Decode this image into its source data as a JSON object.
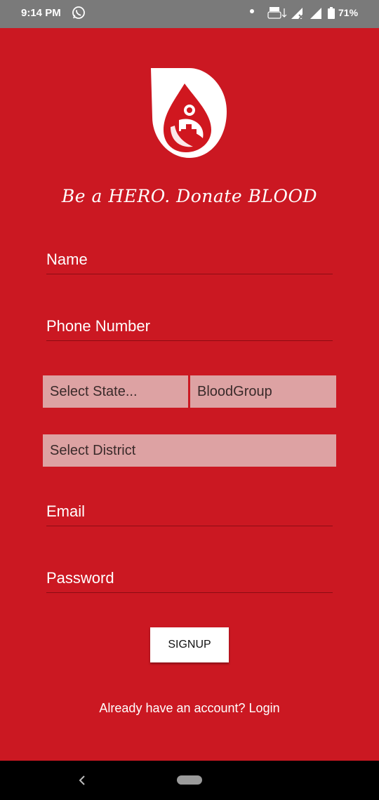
{
  "status_bar": {
    "time": "9:14 PM",
    "battery_percent": "71%",
    "battery_level": 0.71,
    "icons": [
      "whatsapp-icon",
      "notification-dot-icon",
      "volte-icon",
      "signal-icon",
      "4g-signal-icon",
      "battery-icon"
    ]
  },
  "header": {
    "logo_icon": "blood-drop-logo-icon",
    "tagline": "Be a HERO. Donate BLOOD"
  },
  "form": {
    "name_placeholder": "Name",
    "phone_placeholder": "Phone Number",
    "state_select": "Select State...",
    "blood_group_select": "BloodGroup",
    "district_select": "Select District",
    "email_placeholder": "Email",
    "password_placeholder": "Password",
    "signup_label": "SIGNUP",
    "login_prompt": "Already have an account? Login"
  },
  "nav_bar": {
    "back_icon": "back-chevron-icon",
    "home_icon": "home-pill-icon"
  },
  "colors": {
    "background": "#cb1822",
    "select_fill": "#dda2a3",
    "underline": "#8d0c13",
    "status_bar": "#7a7a7a"
  }
}
